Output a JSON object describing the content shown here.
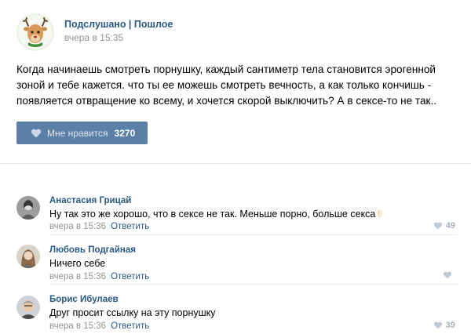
{
  "post": {
    "author": "Подслушано | Пошлое",
    "time": "вчера в 15:35",
    "text": "Когда начинаешь смотреть порнушку, каждый сантиметр тела становится эрогенной зоной и тебе кажется. что ты ее можешь смотреть вечность, а как только кончишь - появляется отвращение ко всему, и хочется скорой выключить? А в сексе-то не так..",
    "like_label": "Мне нравится",
    "like_count": "3270",
    "avatar_icon": "deer-icon"
  },
  "comments": [
    {
      "author": "Анастасия Грицай",
      "text": "Ну так это же хорошо, что в сексе не так. Меньше порно, больше секса",
      "emoji": "✌",
      "time": "вчера в 15:36",
      "reply": "Ответить",
      "likes": "49"
    },
    {
      "author": "Любовь Подгайная",
      "text": "Ничего себе",
      "time": "вчера в 15:36",
      "reply": "Ответить",
      "likes": ""
    },
    {
      "author": "Борис Ибулаев",
      "text": "Друг просит ссылку на эту порнушку",
      "time": "вчера в 15:36",
      "reply": "Ответить",
      "likes": "39"
    }
  ],
  "colors": {
    "link": "#2a5885",
    "button": "#5b7fa6",
    "meta": "#939393",
    "like_inactive": "#a7b2bd"
  }
}
